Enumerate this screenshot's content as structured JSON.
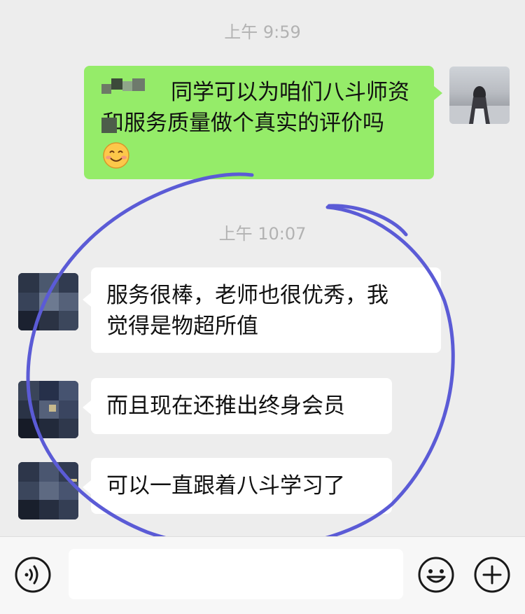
{
  "chat": {
    "timestamps": [
      "上午 9:59",
      "上午 10:07"
    ],
    "outgoing": {
      "line1": "同学可以为咱们八斗师资",
      "line2": "和服务质量做个真实的评价吗"
    },
    "incoming": [
      {
        "line1": "服务很棒，老师也很优秀，我",
        "line2": "觉得是物超所值"
      },
      {
        "line1": "而且现在还推出终身会员"
      },
      {
        "line1": "可以一直跟着八斗学习了"
      }
    ]
  },
  "colors": {
    "outgoing_bubble": "#95ec69",
    "incoming_bubble": "#ffffff",
    "annotation_circle": "#5b5bd6",
    "background": "#ededed"
  },
  "input_bar": {
    "icons": [
      "voice-icon",
      "emoji-icon",
      "plus-icon"
    ]
  }
}
